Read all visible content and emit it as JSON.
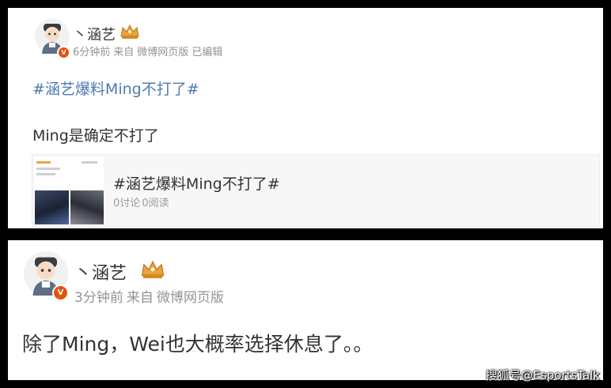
{
  "post1": {
    "username": "丶涵艺",
    "meta": {
      "time": "6分钟前",
      "source_prefix": "来自",
      "source": "微博网页版",
      "edited": "已编辑"
    },
    "hashtag": "#涵艺爆料Ming不打了#",
    "text": "Ming是确定不打了",
    "card": {
      "title": "#涵艺爆料Ming不打了#",
      "discussions": "0讨论",
      "reads": "0阅读"
    },
    "verify_badge": "V"
  },
  "post2": {
    "username": "丶涵艺",
    "meta": {
      "time": "3分钟前",
      "source_prefix": "来自",
      "source": "微博网页版"
    },
    "text": "除了Ming，Wei也大概率选择休息了。。",
    "verify_badge": "V"
  },
  "watermark": "搜狐号@EsportsTalk",
  "colors": {
    "frame": "#000000",
    "hashtag": "#4f7bb0",
    "meta_gray": "#939393",
    "verify_orange": "#e8500c",
    "crown_gold": "#e8a33a"
  },
  "icons": [
    "avatar-icon",
    "verify-badge-icon",
    "crown-icon"
  ]
}
